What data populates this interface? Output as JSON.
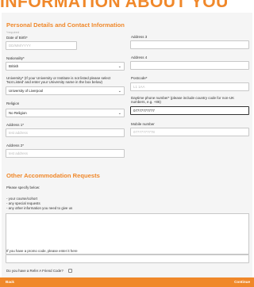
{
  "page_title": "INFORMATION ABOUT YOU",
  "section1": {
    "title": "Personal Details and Contact Information",
    "required_note": "*required"
  },
  "left": {
    "dob": {
      "label": "Date of Birth*",
      "placeholder": "DD/MM/YYYY"
    },
    "nationality": {
      "label": "Nationality*",
      "value": "British"
    },
    "university": {
      "label_line1": "University* (If your University or Institute is not listed please select",
      "label_line2": "'Not Listed' and enter your University name in the box below)",
      "value": "University of Liverpool"
    },
    "religion": {
      "label": "Religion",
      "value": "No Religion"
    },
    "address1": {
      "label": "Address 1*",
      "placeholder": "test address"
    },
    "address2": {
      "label": "Address 2*",
      "placeholder": "test address"
    }
  },
  "right": {
    "address3": {
      "label": "Address 3",
      "placeholder": ""
    },
    "address4": {
      "label": "Address 4",
      "placeholder": ""
    },
    "postcode": {
      "label": "Postcode*",
      "placeholder": "L1 1AA"
    },
    "daytime_phone": {
      "label_line1": "Daytime phone number* (please include country code for non-UK",
      "label_line2": "numbers, e.g. +86)",
      "value": "07777777777"
    },
    "mobile": {
      "label": "Mobile number",
      "placeholder": "07777777778"
    }
  },
  "section2": {
    "title": "Other Accommodation Requests",
    "intro": "Please specify below:",
    "bullets": [
      "- your course/cohort",
      "- any special requests",
      "- any other information you need to give us"
    ]
  },
  "promo": {
    "label": "If you have a promo code, please enter it here"
  },
  "refer": {
    "label": "Do you have a Refer A Friend Code?"
  },
  "footer": {
    "back": "Back",
    "continue": "Continue"
  }
}
